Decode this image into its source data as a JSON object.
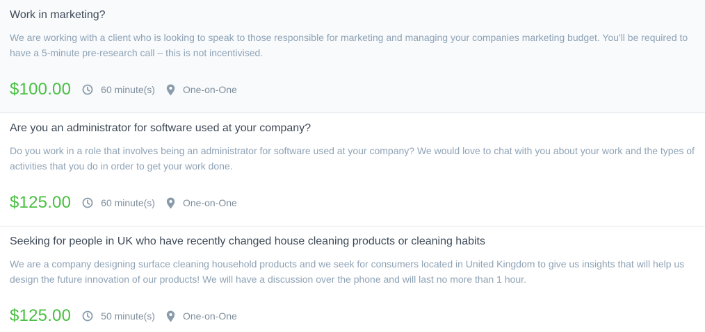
{
  "colors": {
    "price": "#49c041",
    "title": "#3e4a57",
    "description": "#8ea2b5",
    "meta": "#7f8e9c",
    "icon": "#8a9cab",
    "highlight_bg": "#f8fafc"
  },
  "studies": [
    {
      "title": "Work in marketing?",
      "description": "We are working with a client who is looking to speak to those responsible for marketing and managing your companies marketing budget. You'll be required to have a 5-minute pre-research call – this is not incentivised.",
      "price": "$100.00",
      "duration": "60 minute(s)",
      "format": "One-on-One",
      "duration_icon": "clock-icon",
      "format_icon": "location-pin-icon"
    },
    {
      "title": "Are you an administrator for software used at your company?",
      "description": "Do you work in a role that involves being an administrator for software used at your company? We would love to chat with you about your work and the types of activities that you do in order to get your work done.",
      "price": "$125.00",
      "duration": "60 minute(s)",
      "format": "One-on-One",
      "duration_icon": "clock-icon",
      "format_icon": "location-pin-icon"
    },
    {
      "title": "Seeking for people in UK who have recently changed house cleaning products or cleaning habits",
      "description": "We are a company designing surface cleaning household products and we seek for consumers located in United Kingdom to give us insights that will help us design the future innovation of our products! We will have a discussion over the phone and will last no more than 1 hour.",
      "price": "$125.00",
      "duration": "50 minute(s)",
      "format": "One-on-One",
      "duration_icon": "clock-icon",
      "format_icon": "location-pin-icon"
    }
  ]
}
